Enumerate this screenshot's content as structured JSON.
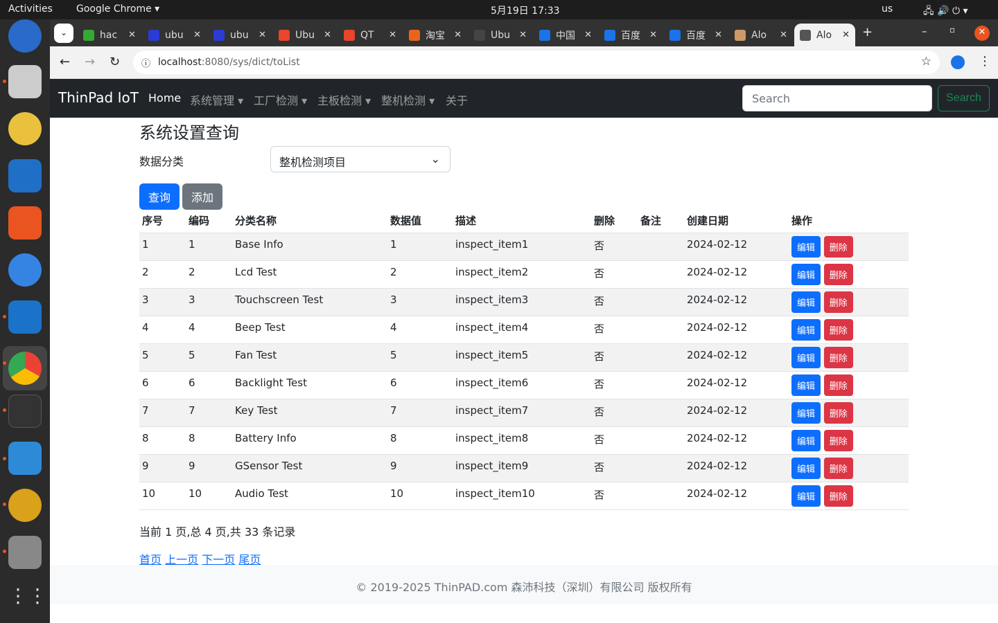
{
  "system": {
    "activities": "Activities",
    "app": "Google Chrome",
    "clock": "5月19日  17:33",
    "keyboard": "us"
  },
  "tabs": [
    {
      "label": "hac"
    },
    {
      "label": "ubu"
    },
    {
      "label": "ubu"
    },
    {
      "label": "Ubu"
    },
    {
      "label": "QT"
    },
    {
      "label": "淘宝"
    },
    {
      "label": "Ubu"
    },
    {
      "label": "中国"
    },
    {
      "label": "百度"
    },
    {
      "label": "百度"
    },
    {
      "label": "Alo"
    },
    {
      "label": "Alo"
    }
  ],
  "browser": {
    "url_host": "localhost",
    "url_rest": ":8080/sys/dict/toList"
  },
  "navbar": {
    "brand": "ThinPad IoT",
    "items": [
      "Home",
      "系统管理 ▾",
      "工厂检测 ▾",
      "主板检测 ▾",
      "整机检测 ▾",
      "关于"
    ],
    "search_placeholder": "Search",
    "search_button": "Search"
  },
  "page": {
    "title": "系统设置查询",
    "filter_label": "数据分类",
    "filter_value": "整机检测项目",
    "query_button": "查询",
    "add_button": "添加"
  },
  "table": {
    "headers": [
      "序号",
      "编码",
      "分类名称",
      "数据值",
      "描述",
      "删除",
      "备注",
      "创建日期",
      "操作"
    ],
    "rows": [
      [
        "1",
        "1",
        "Base Info",
        "1",
        "inspect_item1",
        "否",
        "",
        "2024-02-12"
      ],
      [
        "2",
        "2",
        "Lcd Test",
        "2",
        "inspect_item2",
        "否",
        "",
        "2024-02-12"
      ],
      [
        "3",
        "3",
        "Touchscreen Test",
        "3",
        "inspect_item3",
        "否",
        "",
        "2024-02-12"
      ],
      [
        "4",
        "4",
        "Beep Test",
        "4",
        "inspect_item4",
        "否",
        "",
        "2024-02-12"
      ],
      [
        "5",
        "5",
        "Fan Test",
        "5",
        "inspect_item5",
        "否",
        "",
        "2024-02-12"
      ],
      [
        "6",
        "6",
        "Backlight Test",
        "6",
        "inspect_item6",
        "否",
        "",
        "2024-02-12"
      ],
      [
        "7",
        "7",
        "Key Test",
        "7",
        "inspect_item7",
        "否",
        "",
        "2024-02-12"
      ],
      [
        "8",
        "8",
        "Battery Info",
        "8",
        "inspect_item8",
        "否",
        "",
        "2024-02-12"
      ],
      [
        "9",
        "9",
        "GSensor Test",
        "9",
        "inspect_item9",
        "否",
        "",
        "2024-02-12"
      ],
      [
        "10",
        "10",
        "Audio Test",
        "10",
        "inspect_item10",
        "否",
        "",
        "2024-02-12"
      ]
    ],
    "edit_label": "编辑",
    "delete_label": "删除"
  },
  "pagination": {
    "summary": "当前 1 页,总 4 页,共 33 条记录",
    "links": [
      "首页",
      "上一页",
      "下一页",
      "尾页"
    ]
  },
  "footer": {
    "text": "© 2019-2025 ThinPAD.com 森沛科技（深圳）有限公司 版权所有"
  }
}
